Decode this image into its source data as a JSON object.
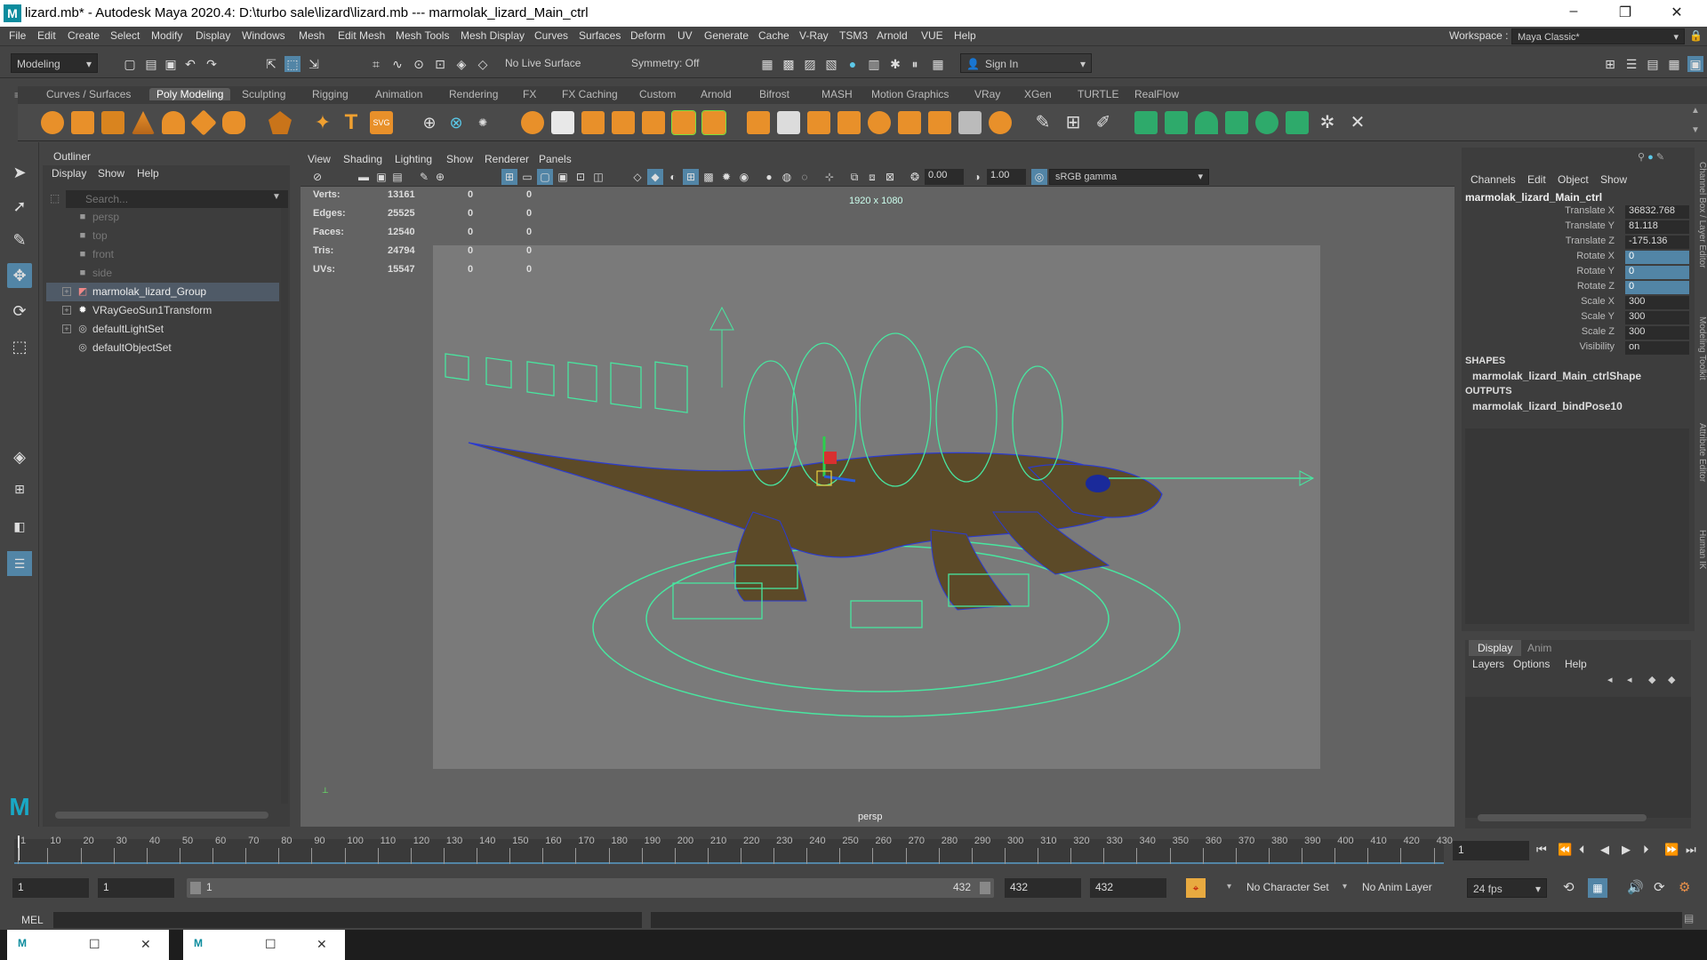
{
  "window": {
    "title": "lizard.mb* - Autodesk Maya 2020.4: D:\\turbo sale\\lizard\\lizard.mb  ---  marmolak_lizard_Main_ctrl",
    "minimize": "–",
    "maximize": "❐",
    "close": "✕"
  },
  "menubar": [
    "File",
    "Edit",
    "Create",
    "Select",
    "Modify",
    "Display",
    "Windows",
    "Mesh",
    "Edit Mesh",
    "Mesh Tools",
    "Mesh Display",
    "Curves",
    "Surfaces",
    "Deform",
    "UV",
    "Generate",
    "Cache",
    "V-Ray",
    "TSM3",
    "Arnold",
    "VUE",
    "Help"
  ],
  "statusline": {
    "mode": "Modeling",
    "live_surface": "No Live Surface",
    "symmetry": "Symmetry: Off",
    "sign_in": "Sign In",
    "workspace_label": "Workspace :",
    "workspace": "Maya Classic*"
  },
  "shelf_tabs": [
    "Curves / Surfaces",
    "Poly Modeling",
    "Sculpting",
    "Rigging",
    "Animation",
    "Rendering",
    "FX",
    "FX Caching",
    "Custom",
    "Arnold",
    "Bifrost",
    "MASH",
    "Motion Graphics",
    "VRay",
    "XGen",
    "TURTLE",
    "RealFlow"
  ],
  "shelf_active": "Poly Modeling",
  "outliner": {
    "title": "Outliner",
    "menus": [
      "Display",
      "Show",
      "Help"
    ],
    "search_placeholder": "Search...",
    "items": [
      {
        "label": "persp",
        "dim": true
      },
      {
        "label": "top",
        "dim": true
      },
      {
        "label": "front",
        "dim": true
      },
      {
        "label": "side",
        "dim": true
      },
      {
        "label": "marmolak_lizard_Group",
        "selected": true
      },
      {
        "label": "VRayGeoSun1Transform"
      },
      {
        "label": "defaultLightSet"
      },
      {
        "label": "defaultObjectSet"
      }
    ]
  },
  "viewport": {
    "menus": [
      "View",
      "Shading",
      "Lighting",
      "Show",
      "Renderer",
      "Panels"
    ],
    "exposure": "0.00",
    "gamma": "1.00",
    "colorspace": "sRGB gamma",
    "resolution": "1920 x 1080",
    "camera": "persp",
    "hud": [
      {
        "label": "Verts:",
        "v1": "13161",
        "v2": "0",
        "v3": "0"
      },
      {
        "label": "Edges:",
        "v1": "25525",
        "v2": "0",
        "v3": "0"
      },
      {
        "label": "Faces:",
        "v1": "12540",
        "v2": "0",
        "v3": "0"
      },
      {
        "label": "Tris:",
        "v1": "24794",
        "v2": "0",
        "v3": "0"
      },
      {
        "label": "UVs:",
        "v1": "15547",
        "v2": "0",
        "v3": "0"
      }
    ]
  },
  "channelbox": {
    "menus": [
      "Channels",
      "Edit",
      "Object",
      "Show"
    ],
    "object": "marmolak_lizard_Main_ctrl",
    "channels": [
      {
        "label": "Translate X",
        "value": "36832.768",
        "key": false
      },
      {
        "label": "Translate Y",
        "value": "81.118",
        "key": false
      },
      {
        "label": "Translate Z",
        "value": "-175.136",
        "key": false
      },
      {
        "label": "Rotate X",
        "value": "0",
        "key": true
      },
      {
        "label": "Rotate Y",
        "value": "0",
        "key": true
      },
      {
        "label": "Rotate Z",
        "value": "0",
        "key": true
      },
      {
        "label": "Scale X",
        "value": "300",
        "key": false
      },
      {
        "label": "Scale Y",
        "value": "300",
        "key": false
      },
      {
        "label": "Scale Z",
        "value": "300",
        "key": false
      },
      {
        "label": "Visibility",
        "value": "on",
        "key": false
      }
    ],
    "shapes_label": "SHAPES",
    "shape": "marmolak_lizard_Main_ctrlShape",
    "outputs_label": "OUTPUTS",
    "output": "marmolak_lizard_bindPose10"
  },
  "layer_editor": {
    "tabs": [
      "Display",
      "Anim"
    ],
    "menus": [
      "Layers",
      "Options",
      "Help"
    ]
  },
  "side_tabs": [
    "Channel Box / Layer Editor",
    "Modeling Toolkit",
    "Attribute Editor",
    "Human IK"
  ],
  "timeline": {
    "ticks": [
      "1",
      "10",
      "20",
      "30",
      "40",
      "50",
      "60",
      "70",
      "80",
      "90",
      "100",
      "110",
      "120",
      "130",
      "140",
      "150",
      "160",
      "170",
      "180",
      "190",
      "200",
      "210",
      "220",
      "230",
      "240",
      "250",
      "260",
      "270",
      "280",
      "290",
      "300",
      "310",
      "320",
      "330",
      "340",
      "350",
      "360",
      "370",
      "380",
      "390",
      "400",
      "410",
      "420",
      "430"
    ],
    "current_frame": "1"
  },
  "range": {
    "start": "1",
    "anim_start": "1",
    "range_start": "1",
    "range_end": "432",
    "anim_end": "432",
    "end": "432",
    "character_set": "No Character Set",
    "anim_layer": "No Anim Layer",
    "fps": "24 fps"
  },
  "mel": {
    "label": "MEL"
  }
}
